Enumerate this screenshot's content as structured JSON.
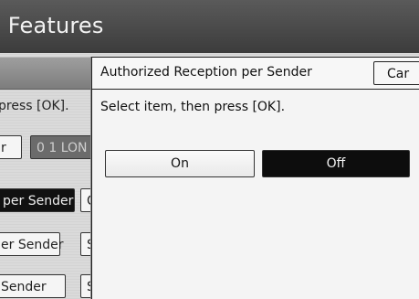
{
  "background": {
    "title": "e Features",
    "instruction": "press [OK].",
    "buttons": {
      "row1_left": "r",
      "row1_right": "0 1 LON",
      "row2_left": "per Sender",
      "row2_right": "C",
      "row3_left": "er Sender",
      "row3_right": "S",
      "row4_left": "Sender",
      "row4_right": "S"
    }
  },
  "dialog": {
    "title": "Authorized Reception per Sender",
    "cancel_label": "Car",
    "instruction": "Select item, then press [OK].",
    "options": {
      "on": "On",
      "off": "Off",
      "selected": "Off"
    }
  }
}
